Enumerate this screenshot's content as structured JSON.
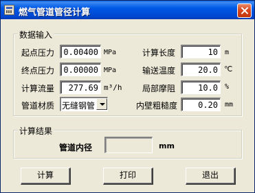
{
  "window": {
    "title": "燃气管道管径计算"
  },
  "input_group": {
    "label": "数据输入",
    "start_pressure": {
      "label": "起点压力",
      "value": "0.00400",
      "unit": "MPa"
    },
    "end_pressure": {
      "label": "终点压力",
      "value": "0.00000",
      "unit": "MPa"
    },
    "flow": {
      "label": "计算流量",
      "value": "277.69",
      "unit": "m³/h"
    },
    "material": {
      "label": "管道材质",
      "selected": "无缝钢管"
    },
    "calc_length": {
      "label": "计算长度",
      "value": "10",
      "unit": "m"
    },
    "temperature": {
      "label": "输送温度",
      "value": "20.0",
      "unit": "℃"
    },
    "local_friction": {
      "label": "局部摩阻",
      "value": "10.0",
      "unit": "%"
    },
    "roughness": {
      "label": "内壁粗糙度",
      "value": "0.20",
      "unit": "mm"
    }
  },
  "result_group": {
    "label": "计算结果",
    "diameter": {
      "label": "管道内径",
      "value": "",
      "unit": "mm"
    }
  },
  "buttons": {
    "calculate": "计算",
    "print": "打印",
    "exit": "退出"
  }
}
